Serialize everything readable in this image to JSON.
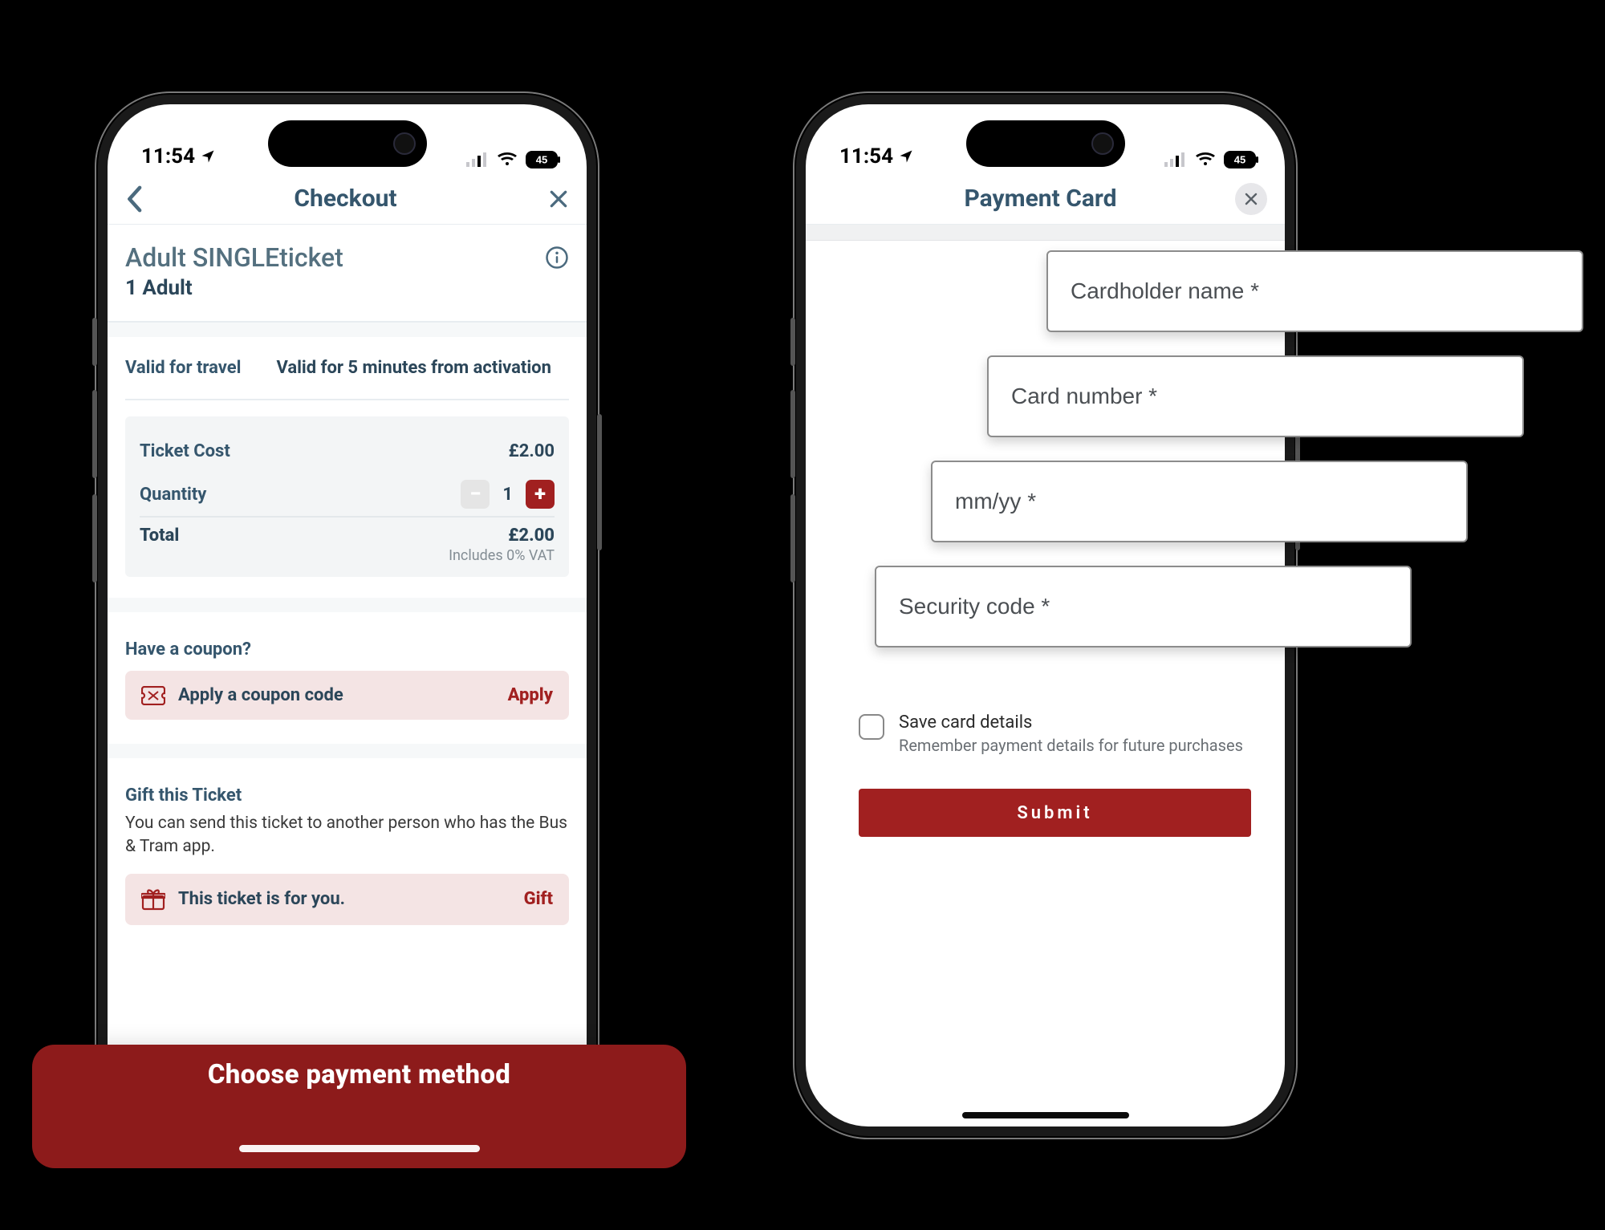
{
  "status": {
    "time": "11:54",
    "battery": "45"
  },
  "screen1": {
    "nav": {
      "title": "Checkout"
    },
    "ticket": {
      "name": "Adult SINGLEticket",
      "sub": "1 Adult"
    },
    "valid": {
      "label": "Valid for travel",
      "value": "Valid for 5 minutes from activation"
    },
    "cost": {
      "ticket_cost_label": "Ticket Cost",
      "ticket_cost_value": "£2.00",
      "quantity_label": "Quantity",
      "quantity_value": "1",
      "total_label": "Total",
      "total_value": "£2.00",
      "vat_note": "Includes 0% VAT"
    },
    "coupon": {
      "heading": "Have a coupon?",
      "row_label": "Apply a coupon code",
      "action": "Apply"
    },
    "gift": {
      "heading": "Gift this Ticket",
      "desc": "You can send this ticket to another person who has the Bus & Tram app.",
      "row_label": "This ticket is for you.",
      "action": "Gift"
    },
    "cta": "Choose payment method"
  },
  "screen2": {
    "nav": {
      "title": "Payment Card"
    },
    "fields": {
      "cardholder": "Cardholder name *",
      "number": "Card number *",
      "expiry": "mm/yy *",
      "cvc": "Security code *"
    },
    "save": {
      "title": "Save card details",
      "sub": "Remember payment details for future purchases"
    },
    "submit": "Submit"
  }
}
